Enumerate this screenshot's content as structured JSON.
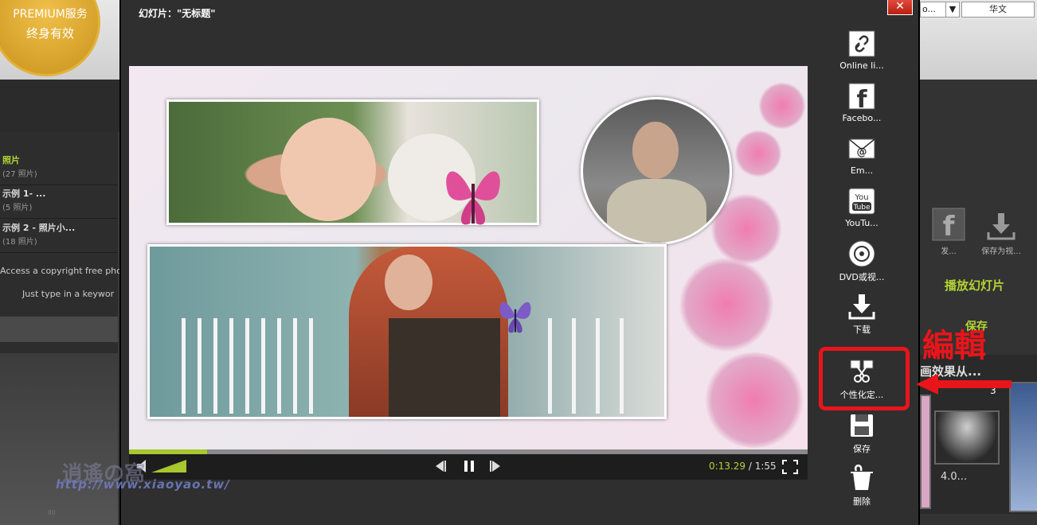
{
  "background": {
    "premium_line1": "PREMIUM服务",
    "premium_line2": "终身有效",
    "albums": [
      {
        "name": "照片",
        "count": "(27 照片)"
      },
      {
        "name": "示例 1- ...",
        "count": "(5 照片)"
      },
      {
        "name": "示例 2 - 照片小...",
        "count": "(18 照片)"
      }
    ],
    "hint1": "Access a copyright free pho",
    "hint2": "Just type in a keywor",
    "topright_box1": "o...",
    "topright_lang": "华文",
    "publish_label": "发...",
    "saveas_label": "保存为视...",
    "play_slideshow": "播放幻灯片",
    "save_label": "保存",
    "effects_label": "画效果从...",
    "thumb_number": "3",
    "thumb_caption": "4.0...",
    "bottom_mark": "IIII"
  },
  "modal": {
    "title": "幻灯片：\"无标题\"",
    "close": "✕",
    "time_current": "0:13.29",
    "time_sep": " / ",
    "time_total": "1:55",
    "progress_fraction": 0.115
  },
  "actions": [
    {
      "label": "Online li...",
      "icon": "link-icon"
    },
    {
      "label": "Facebo...",
      "icon": "facebook-icon"
    },
    {
      "label": "Em...",
      "icon": "email-icon"
    },
    {
      "label": "YouTu...",
      "icon": "youtube-icon"
    },
    {
      "label": "DVD或视...",
      "icon": "dvd-icon"
    },
    {
      "label": "下载",
      "icon": "download-icon"
    },
    {
      "label": "个性化定...",
      "icon": "customize-icon"
    },
    {
      "label": "保存",
      "icon": "save-icon"
    },
    {
      "label": "删除",
      "icon": "delete-icon"
    }
  ],
  "annotation": {
    "edit_label": "編輯",
    "color": "#e8151a"
  },
  "watermark": {
    "text": "http://www.xiaoyao.tw/",
    "logo": "逍遙の窩"
  },
  "colors": {
    "accent": "#b5d334",
    "progress": "#a8c82e"
  }
}
